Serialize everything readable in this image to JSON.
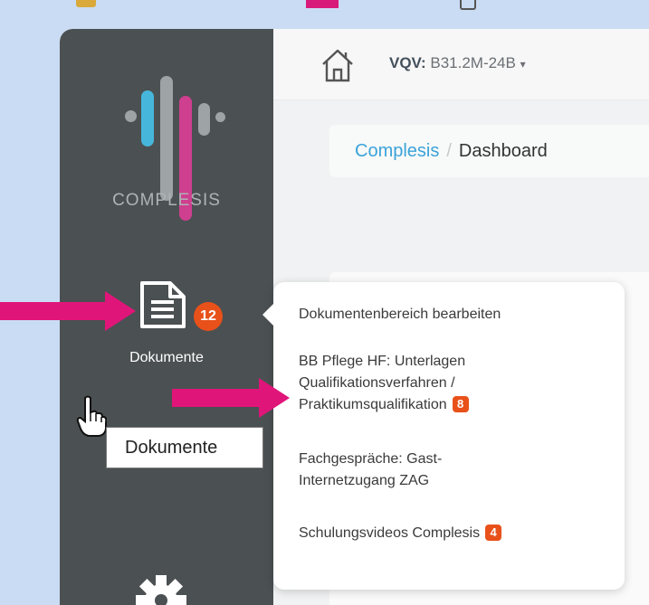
{
  "logo": {
    "text": "COMPLESIS"
  },
  "sidebar": {
    "documents": {
      "label": "Dokumente",
      "badge": "12"
    },
    "tooltip": "Dokumente"
  },
  "topbar": {
    "vqv_prefix": "VQV:",
    "vqv_value": "B31.2M-24B",
    "vqv_caret": "▾"
  },
  "breadcrumb": {
    "link": "Complesis",
    "separator": "/",
    "current": "Dashboard"
  },
  "popover": {
    "items": [
      {
        "lines": [
          "Dokumentenbereich bearbeiten"
        ]
      },
      {
        "lines": [
          "BB Pflege HF: Unterlagen",
          "Qualifikationsverfahren /",
          "Praktikumsqualifikation"
        ],
        "badge": "8"
      },
      {
        "lines": [
          "Fachgespräche: Gast-",
          "Internetzugang ZAG"
        ]
      },
      {
        "lines": [
          "Schulungsvideos Complesis"
        ],
        "badge": "4"
      }
    ]
  },
  "colors": {
    "sidebar": "#4b5052",
    "badge": "#e8511a",
    "arrow": "#e0157a",
    "link": "#3ba3d9",
    "background": "#c9dcf3"
  }
}
